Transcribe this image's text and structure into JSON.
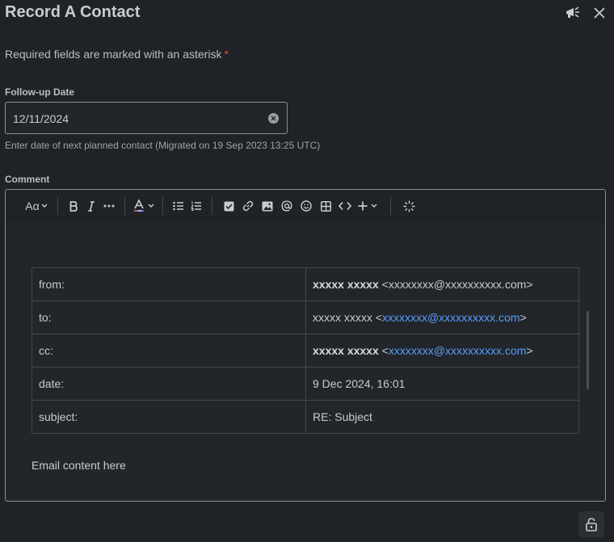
{
  "dialog": {
    "title": "Record A Contact",
    "feedback_icon": "megaphone-icon",
    "close_icon": "close-icon"
  },
  "required_note": {
    "text": "Required fields are marked with an asterisk",
    "marker": "*"
  },
  "follow_up": {
    "label": "Follow-up Date",
    "value": "12/11/2024",
    "help": "Enter date of next planned contact (Migrated on 19 Sep 2023 13:25 UTC)"
  },
  "comment": {
    "label": "Comment",
    "toolbar": {
      "text_style": "Aα",
      "items": [
        "text-style-icon",
        "bold-icon",
        "italic-icon",
        "more-icon",
        "text-color-icon",
        "bullet-list-icon",
        "numbered-list-icon",
        "action-item-icon",
        "link-icon",
        "image-icon",
        "mention-icon",
        "emoji-icon",
        "table-icon",
        "code-icon",
        "insert-plus-icon",
        "ai-sparkle-icon"
      ]
    },
    "email_table": {
      "rows": [
        {
          "key": "from:",
          "name": "xxxxx xxxxx",
          "email": "xxxxxxxx@xxxxxxxxxx.com",
          "bold": true,
          "linked": false
        },
        {
          "key": "to:",
          "name": "xxxxx xxxxx",
          "email": "xxxxxxxx@xxxxxxxxxx.com",
          "bold": false,
          "linked": true
        },
        {
          "key": "cc:",
          "name": "xxxxx xxxxx",
          "email": "xxxxxxxx@xxxxxxxxxx.com",
          "bold": true,
          "linked": true
        },
        {
          "key": "date:",
          "value": "9 Dec 2024, 16:01"
        },
        {
          "key": "subject:",
          "value": "RE: Subject"
        }
      ]
    },
    "content": "Email content here"
  },
  "footer": {
    "lock_icon": "unlock-icon"
  },
  "colors": {
    "background": "#1f2226",
    "link": "#579dff",
    "required": "#e2483d",
    "border": "#8b9097"
  }
}
